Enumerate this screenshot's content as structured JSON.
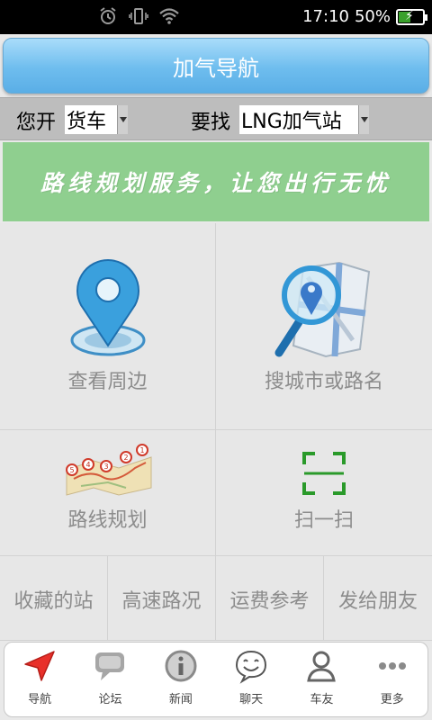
{
  "status_bar": {
    "time": "17:10",
    "battery_percent": "50%",
    "battery_level": 0.5,
    "icons": [
      "alarm-icon",
      "vibrate-icon",
      "wifi-icon",
      "battery-icon"
    ]
  },
  "title": "加气导航",
  "filter": {
    "vehicle_label": "您开",
    "vehicle_value": "货车",
    "target_label": "要找",
    "target_value": "LNG加气站"
  },
  "banner_text": "路线规划服务，让您出行无忧",
  "grid": {
    "nearby": "查看周边",
    "search_city": "搜城市或路名",
    "route_plan": "路线规划",
    "scan": "扫一扫",
    "favorites": "收藏的站",
    "highway": "高速路况",
    "freight": "运费参考",
    "send_friends": "发给朋友"
  },
  "route_pins": [
    "5",
    "4",
    "3",
    "2",
    "1"
  ],
  "bottom_nav": [
    {
      "label": "导航",
      "icon": "navigation-arrow-icon",
      "active": true
    },
    {
      "label": "论坛",
      "icon": "forum-bubble-icon"
    },
    {
      "label": "新闻",
      "icon": "info-icon"
    },
    {
      "label": "聊天",
      "icon": "chat-face-icon"
    },
    {
      "label": "车友",
      "icon": "person-icon"
    },
    {
      "label": "更多",
      "icon": "more-dots-icon"
    }
  ],
  "colors": {
    "titlebar": "#6ebdee",
    "banner": "#8fcf8f",
    "active_nav": "#e8302a",
    "scan_green": "#2a9a2a"
  }
}
